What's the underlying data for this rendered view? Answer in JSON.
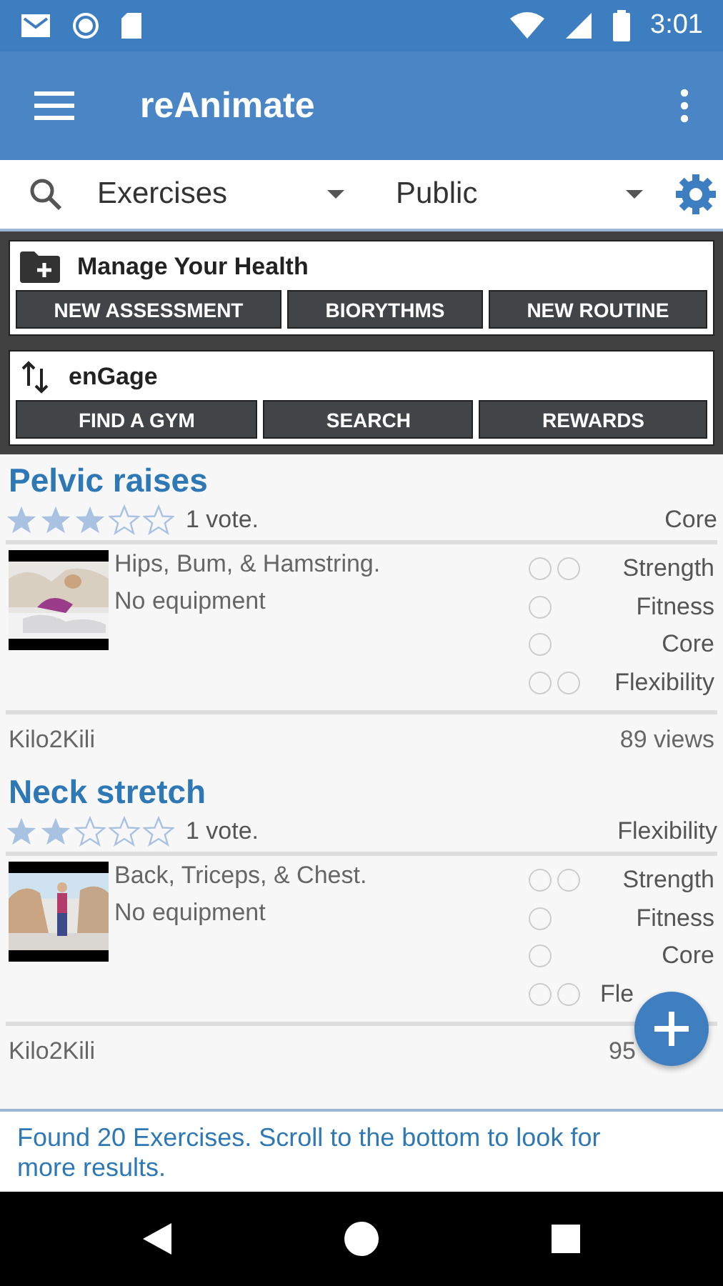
{
  "status_bar": {
    "time": "3:01"
  },
  "app_bar": {
    "title": "reAnimate"
  },
  "filters": [
    {
      "value": "Exercises"
    },
    {
      "value": "Public"
    }
  ],
  "panels": [
    {
      "title": "Manage Your Health",
      "buttons": [
        "NEW ASSESSMENT",
        "BIORYTHMS",
        "NEW ROUTINE"
      ]
    },
    {
      "title": "enGage",
      "buttons": [
        "FIND A GYM",
        "SEARCH",
        "REWARDS"
      ]
    }
  ],
  "exercises": [
    {
      "title": "Pelvic raises",
      "stars": 3,
      "votes": "1 vote.",
      "category": "Core",
      "muscles": "Hips, Bum,  & Hamstring.",
      "equipment": "No equipment",
      "tags": [
        {
          "label": "Strength",
          "covered": false,
          "options": [
            {
              "checked": false
            },
            {
              "checked": false
            }
          ]
        },
        {
          "label": "Fitness",
          "covered": false,
          "options": [
            {
              "checked": false
            }
          ]
        },
        {
          "label": "Core",
          "covered": false,
          "options": [
            {
              "checked": false
            }
          ]
        },
        {
          "label": "Flexibility",
          "covered": false,
          "options": [
            {
              "checked": false
            },
            {
              "checked": false
            }
          ]
        }
      ],
      "author": "Kilo2Kili",
      "views": "89 views",
      "views_covered": false
    },
    {
      "title": "Neck stretch",
      "stars": 2,
      "votes": "1 vote.",
      "category": "Flexibility",
      "muscles": "Back, Triceps,  & Chest.",
      "equipment": "No equipment",
      "tags": [
        {
          "label": "Strength",
          "covered": false,
          "options": [
            {
              "checked": false
            },
            {
              "checked": false
            }
          ]
        },
        {
          "label": "Fitness",
          "covered": false,
          "options": [
            {
              "checked": false
            }
          ]
        },
        {
          "label": "Core",
          "covered": false,
          "options": [
            {
              "checked": false
            }
          ]
        },
        {
          "label": "Fle",
          "covered": true,
          "options": [
            {
              "checked": false
            },
            {
              "checked": false
            }
          ]
        }
      ],
      "author": "Kilo2Kili",
      "views": "95",
      "views_covered": true
    }
  ],
  "footer": "Found 20 Exercises. Scroll to the bottom to look for more results."
}
